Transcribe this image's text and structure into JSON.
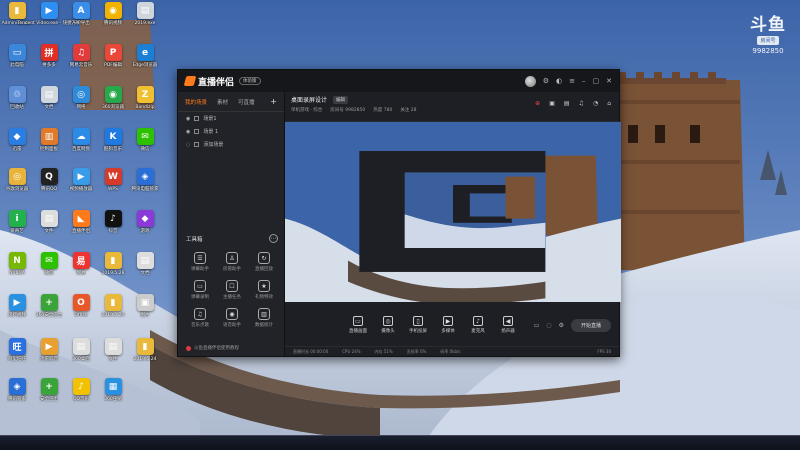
{
  "wallpaper": {
    "sky_color": "#3c64a8",
    "snow_color": "#e9eef6",
    "wall_color": "#8a5a3c"
  },
  "watermark": {
    "logo": "斗鱼",
    "tag": "房间号",
    "room_number": "9982850"
  },
  "desktop_icons": [
    {
      "label": "Administrator",
      "icon": "folder-icon",
      "color": "#e8b93a",
      "glyph": "▮"
    },
    {
      "label": "Tencent Video.exe - 快捷方式",
      "icon": "tencent-video-icon",
      "color": "#2e8ff0",
      "glyph": "▶"
    },
    {
      "label": "APP导出",
      "icon": "a-icon",
      "color": "#3a8ee8",
      "glyph": "A"
    },
    {
      "label": "腾讯视频",
      "icon": "video-icon",
      "color": "#f2b300",
      "glyph": "◉"
    },
    {
      "label": "2019.exe",
      "icon": "file-icon",
      "color": "#cfd5dc",
      "glyph": "▤"
    },
    {
      "label": "此电脑",
      "icon": "computer-icon",
      "color": "#3b86d9",
      "glyph": "▭"
    },
    {
      "label": "拼多多",
      "icon": "app-icon",
      "color": "#e02e24",
      "glyph": "拼"
    },
    {
      "label": "网易云音乐",
      "icon": "music-icon",
      "color": "#e23b3b",
      "glyph": "♫"
    },
    {
      "label": "PDF编辑",
      "icon": "pdf-icon",
      "color": "#e8473a",
      "glyph": "P"
    },
    {
      "label": "Edge浏览器",
      "icon": "edge-icon",
      "color": "#1b7fd4",
      "glyph": "e"
    },
    {
      "label": "回收站",
      "icon": "recycle-icon",
      "color": "#5f8fd6",
      "glyph": "♲"
    },
    {
      "label": "文档",
      "icon": "doc-icon",
      "color": "#d0d6de",
      "glyph": "▤"
    },
    {
      "label": "网络",
      "icon": "network-icon",
      "color": "#2f8ad8",
      "glyph": "◎"
    },
    {
      "label": "360浏览器",
      "icon": "browser-icon",
      "color": "#27a84a",
      "glyph": "◉"
    },
    {
      "label": "Bandizip",
      "icon": "zip-icon",
      "color": "#f0c030",
      "glyph": "Z"
    },
    {
      "label": "迅雷",
      "icon": "thunder-icon",
      "color": "#2a7de1",
      "glyph": "◆"
    },
    {
      "label": "控制面板",
      "icon": "control-icon",
      "color": "#e07a2a",
      "glyph": "▥"
    },
    {
      "label": "百度网盘",
      "icon": "cloud-icon",
      "color": "#2d8be8",
      "glyph": "☁"
    },
    {
      "label": "酷狗音乐",
      "icon": "kugou-icon",
      "color": "#1e7ae0",
      "glyph": "K"
    },
    {
      "label": "微信",
      "icon": "wechat-icon",
      "color": "#2dc100",
      "glyph": "✉"
    },
    {
      "label": "谷歌浏览器",
      "icon": "chrome-icon",
      "color": "#e8b33a",
      "glyph": "◎"
    },
    {
      "label": "腾讯QQ",
      "icon": "qq-icon",
      "color": "#222",
      "glyph": "Q"
    },
    {
      "label": "视频播放器",
      "icon": "player-icon",
      "color": "#3a9be8",
      "glyph": "▶"
    },
    {
      "label": "WPS",
      "icon": "wps-icon",
      "color": "#d63a2a",
      "glyph": "W"
    },
    {
      "label": "腾讯电脑管家",
      "icon": "guard-icon",
      "color": "#2a6fd6",
      "glyph": "◈"
    },
    {
      "label": "爱奇艺",
      "icon": "iqiyi-icon",
      "color": "#22b14c",
      "glyph": "i"
    },
    {
      "label": "文件",
      "icon": "file-icon",
      "color": "#ddd",
      "glyph": "▤"
    },
    {
      "label": "直播伴侣",
      "icon": "live-icon",
      "color": "#ff7a1a",
      "glyph": "◣"
    },
    {
      "label": "抖音",
      "icon": "douyin-icon",
      "color": "#111",
      "glyph": "♪"
    },
    {
      "label": "游戏",
      "icon": "game-icon",
      "color": "#8a3ad6",
      "glyph": "◆"
    },
    {
      "label": "NVIDIA",
      "icon": "nvidia-icon",
      "color": "#76b900",
      "glyph": "N"
    },
    {
      "label": "微信",
      "icon": "wechat-icon",
      "color": "#2dc100",
      "glyph": "✉"
    },
    {
      "label": "网易",
      "icon": "app-icon",
      "color": "#e33",
      "glyph": "易"
    },
    {
      "label": "2019.5.28",
      "icon": "folder-icon",
      "color": "#e8b93a",
      "glyph": "▮"
    },
    {
      "label": "文档",
      "icon": "doc-icon",
      "color": "#ddd",
      "glyph": "▤"
    },
    {
      "label": "风行视频",
      "icon": "video-icon",
      "color": "#2a90e0",
      "glyph": "▶"
    },
    {
      "label": "360安全卫士",
      "icon": "security-icon",
      "color": "#3aa43a",
      "glyph": "+"
    },
    {
      "label": "Office",
      "icon": "office-icon",
      "color": "#e8572a",
      "glyph": "O"
    },
    {
      "label": "2019.5.24",
      "icon": "folder-icon",
      "color": "#e8b93a",
      "glyph": "▮"
    },
    {
      "label": "图片",
      "icon": "image-icon",
      "color": "#ccc",
      "glyph": "▣"
    },
    {
      "label": "阿里旺旺",
      "icon": "ww-icon",
      "color": "#2a70e0",
      "glyph": "旺"
    },
    {
      "label": "迅雷影音",
      "icon": "player-icon",
      "color": "#e8a030",
      "glyph": "▶"
    },
    {
      "label": "360桌面",
      "icon": "desk-icon",
      "color": "#ddd",
      "glyph": "▤"
    },
    {
      "label": "文件",
      "icon": "file-icon",
      "color": "#ddd",
      "glyph": "▤"
    },
    {
      "label": "2019.5.24",
      "icon": "folder-icon",
      "color": "#e8b93a",
      "glyph": "▮"
    },
    {
      "label": "腾讯管家",
      "icon": "shield-icon",
      "color": "#2a6fd6",
      "glyph": "◈"
    },
    {
      "label": "安全卫士",
      "icon": "security-icon",
      "color": "#3aa43a",
      "glyph": "+"
    },
    {
      "label": "QQ音乐",
      "icon": "qqmusic-icon",
      "color": "#f2c200",
      "glyph": "♪"
    },
    {
      "label": "360压缩",
      "icon": "zip-icon",
      "color": "#2a90e0",
      "glyph": "▦"
    }
  ],
  "app": {
    "brand": "直播伴侣",
    "brand_badge": "体验版",
    "side_tabs": [
      "我的场景",
      "素材",
      "可直播"
    ],
    "side_add": "+",
    "scenes": [
      "场景1",
      "场景 1",
      "添加场景"
    ],
    "tools_title": "工具箱",
    "tools": [
      {
        "label": "弹幕助手",
        "glyph": "☰"
      },
      {
        "label": "房管助手",
        "glyph": "♙"
      },
      {
        "label": "直播回放",
        "glyph": "↻"
      },
      {
        "label": "弹幕录制",
        "glyph": "▭"
      },
      {
        "label": "主播任务",
        "glyph": "☐"
      },
      {
        "label": "礼物特效",
        "glyph": "★"
      },
      {
        "label": "音乐点歌",
        "glyph": "♫"
      },
      {
        "label": "语音助手",
        "glyph": "◉"
      },
      {
        "label": "数据统计",
        "glyph": "▥"
      }
    ],
    "side_footer": "斗鱼直播伴侣使用教程",
    "room_title": "桌面录屏设计",
    "edit_label": "编辑",
    "room_meta": [
      "单机游戏 · 综合",
      "房间号 9982850",
      "热度 780",
      "关注 28"
    ],
    "top_icons": [
      "⊕",
      "▣",
      "▤",
      "♫",
      "◔",
      "⌂"
    ],
    "controls": [
      {
        "label": "直播画面",
        "glyph": "▭"
      },
      {
        "label": "摄像头",
        "glyph": "◎"
      },
      {
        "label": "手机投屏",
        "glyph": "▯"
      },
      {
        "label": "多媒体",
        "glyph": "▶"
      },
      {
        "label": "麦克风",
        "glyph": "♪"
      },
      {
        "label": "扬声器",
        "glyph": "◀"
      }
    ],
    "live_label": "开始直播",
    "status": [
      "直播时长 00:00:00",
      "CPU 24%",
      "内存 51%",
      "丢帧率 0%",
      "码率 0kb/s",
      "FPS 30"
    ]
  }
}
